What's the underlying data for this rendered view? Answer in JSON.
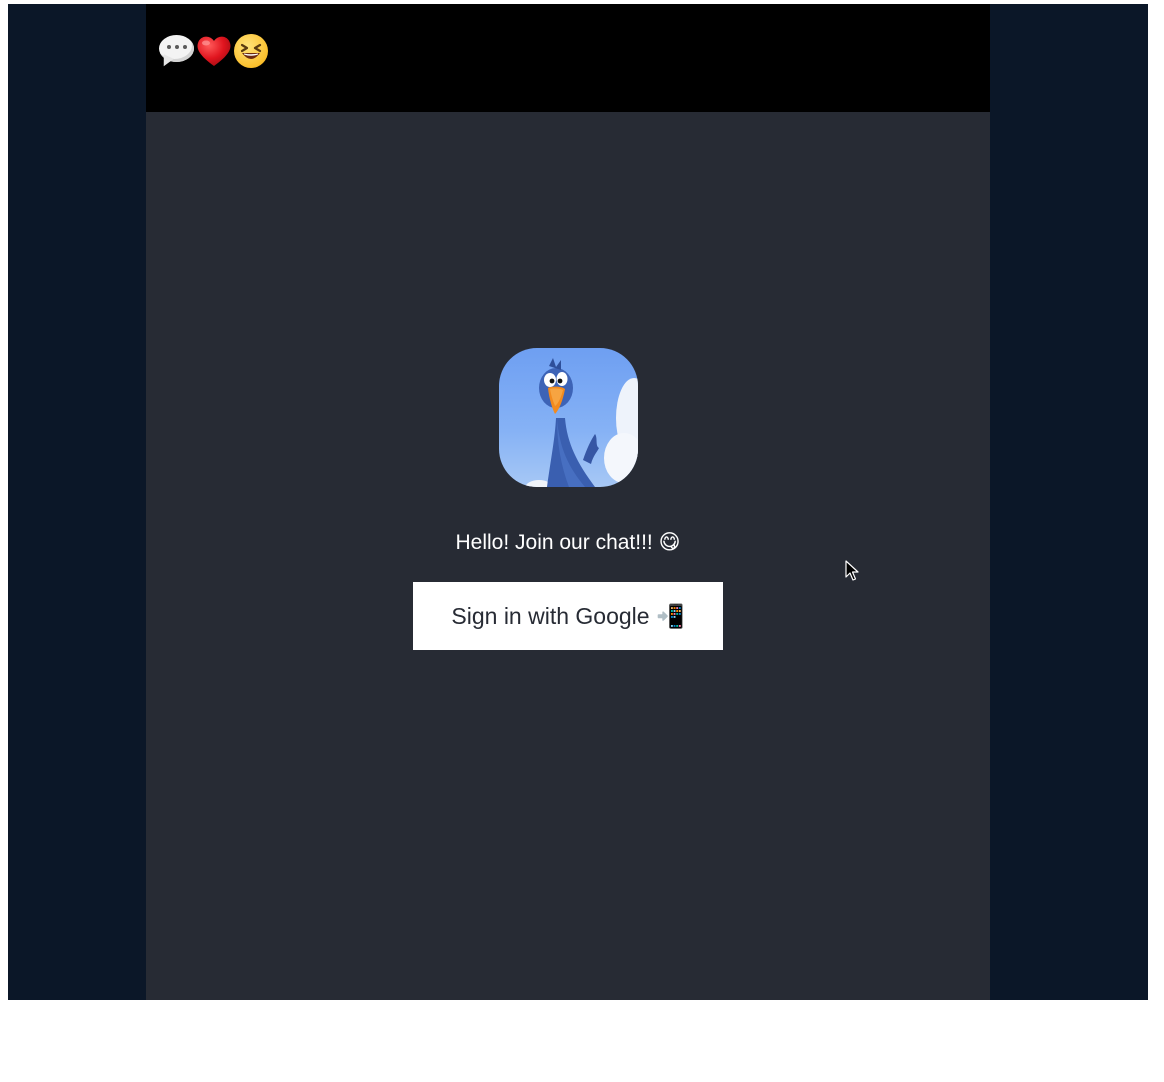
{
  "header": {
    "logo_icons": [
      "speech-bubble-icon",
      "red-heart-icon",
      "laughing-face-icon"
    ]
  },
  "main": {
    "avatar_alt": "blue bird avatar",
    "greeting": "Hello! Join our chat!!! 😋",
    "signin_label": "Sign in with Google 📲"
  },
  "colors": {
    "outer_background": "#0b1728",
    "app_background": "#272b34",
    "header_background": "#000000",
    "button_background": "#ffffff",
    "greeting_text": "#ffffff"
  }
}
